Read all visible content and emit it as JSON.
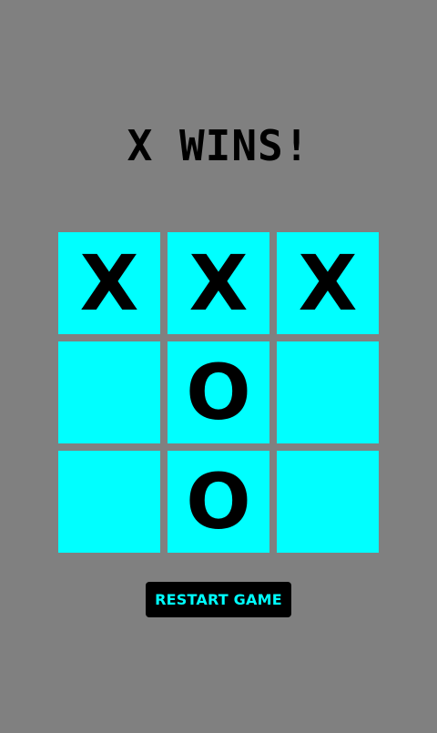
{
  "status": "X WINS!",
  "board": {
    "cells": [
      "X",
      "X",
      "X",
      "",
      "O",
      "",
      "",
      "O",
      ""
    ]
  },
  "restart_label": "RESTART GAME",
  "colors": {
    "background": "#808080",
    "cell": "#00ffff",
    "mark": "#000000",
    "button_bg": "#000000",
    "button_text": "#00ffff"
  }
}
